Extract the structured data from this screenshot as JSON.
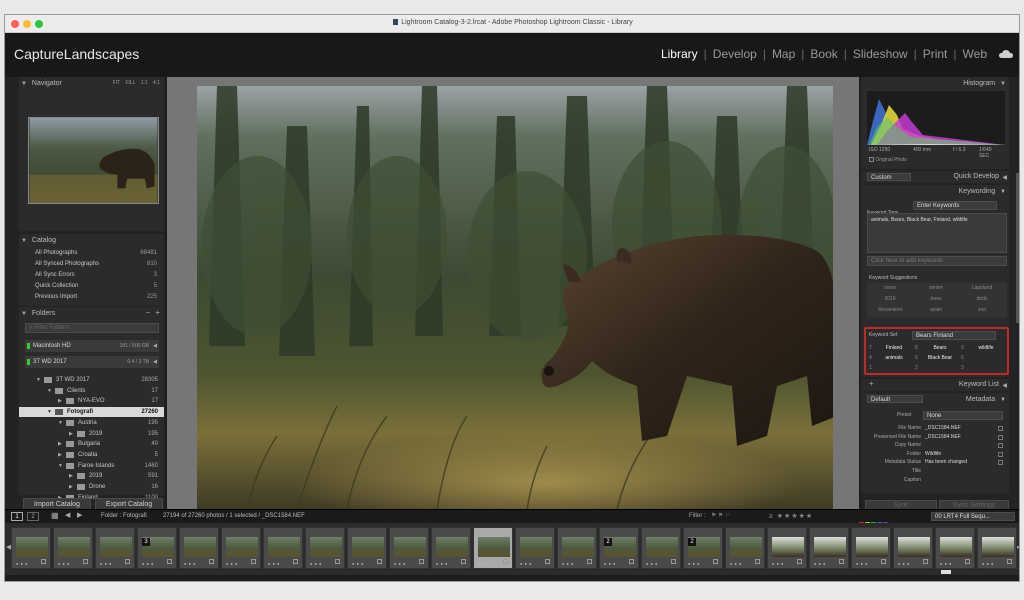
{
  "window": {
    "title": "Lightroom Catalog-3-2.lrcat - Adobe Photoshop Lightroom Classic - Library",
    "traffic_lights": [
      "#fd5f57",
      "#febc2e",
      "#28c840"
    ]
  },
  "identity": {
    "plate": "CaptureLandscapes",
    "modules": [
      {
        "label": "Library",
        "active": true
      },
      {
        "label": "Develop",
        "active": false
      },
      {
        "label": "Map",
        "active": false
      },
      {
        "label": "Book",
        "active": false
      },
      {
        "label": "Slideshow",
        "active": false
      },
      {
        "label": "Print",
        "active": false
      },
      {
        "label": "Web",
        "active": false
      }
    ],
    "cloud_icon": "cloud-icon"
  },
  "navigator": {
    "title": "Navigator",
    "zoom_options": [
      "FIT",
      "FILL",
      "1:1",
      "4:1"
    ]
  },
  "catalog": {
    "title": "Catalog",
    "items": [
      {
        "label": "All Photographs",
        "count": "68481"
      },
      {
        "label": "All Synced Photographs",
        "count": "810"
      },
      {
        "label": "All Sync Errors",
        "count": "3"
      },
      {
        "label": "Quick Collection",
        "count": "5"
      },
      {
        "label": "Previous Import",
        "count": "225"
      }
    ]
  },
  "folders": {
    "title": "Folders",
    "filter_placeholder": "Filter Folders",
    "volumes": [
      {
        "label": "Macintosh HD",
        "size": "181 / 500 GB"
      },
      {
        "label": "3T WD 2017",
        "size": "0.4 / 3 TB"
      }
    ],
    "tree": [
      {
        "label": "3T WD 2017",
        "count": "28305",
        "depth": 1,
        "open": true
      },
      {
        "label": "Clients",
        "count": "17",
        "depth": 2,
        "open": true
      },
      {
        "label": "NYA-EVO",
        "count": "17",
        "depth": 3,
        "open": false
      },
      {
        "label": "Fotografi",
        "count": "27260",
        "depth": 2,
        "open": true,
        "selected": true
      },
      {
        "label": "Austria",
        "count": "195",
        "depth": 3,
        "open": true
      },
      {
        "label": "2019",
        "count": "195",
        "depth": 4,
        "open": false
      },
      {
        "label": "Bulgaria",
        "count": "40",
        "depth": 3,
        "open": false
      },
      {
        "label": "Croatia",
        "count": "5",
        "depth": 3,
        "open": false
      },
      {
        "label": "Faroe Islands",
        "count": "1460",
        "depth": 3,
        "open": true
      },
      {
        "label": "2019",
        "count": "591",
        "depth": 4,
        "open": false
      },
      {
        "label": "Drone",
        "count": "16",
        "depth": 4,
        "open": false
      },
      {
        "label": "Finland",
        "count": "1100",
        "depth": 3,
        "open": false
      }
    ],
    "import_button": "Import Catalog",
    "export_button": "Export Catalog"
  },
  "histogram": {
    "title": "Histogram",
    "iso": "ISO 1250",
    "focal": "400 mm",
    "aperture": "f / 6.3",
    "shutter": "1/640 SEC",
    "original_photo": "Original Photo"
  },
  "quick_develop": {
    "title": "Quick Develop",
    "preset": "Custom"
  },
  "keywording": {
    "title": "Keywording",
    "tags_label": "Keyword Tags",
    "tags_dropdown": "Enter Keywords",
    "keywords_text": "animals, Bears, Black Bear, Finland, wildlife",
    "add_placeholder": "Click here to add keywords",
    "suggestions_label": "Keyword Suggestions",
    "suggestions": [
      "snow",
      "winter",
      "Lappland",
      "2019",
      "trees",
      "birds",
      "Rovaniemi",
      "spain",
      "zoo"
    ],
    "set_label": "Keyword Set",
    "set_value": "Bears Finland",
    "set_keywords": [
      {
        "key": "7",
        "label": "Finland"
      },
      {
        "key": "8",
        "label": "Bears"
      },
      {
        "key": "9",
        "label": "wildlife"
      },
      {
        "key": "4",
        "label": "animals"
      },
      {
        "key": "5",
        "label": "Black Bear"
      },
      {
        "key": "6",
        "label": ""
      },
      {
        "key": "1",
        "label": ""
      },
      {
        "key": "2",
        "label": ""
      },
      {
        "key": "3",
        "label": ""
      }
    ],
    "highlight_color": "#c0282a"
  },
  "keyword_list": {
    "title": "Keyword List"
  },
  "metadata": {
    "title": "Metadata",
    "view": "Default",
    "preset_label": "Preset",
    "preset_value": "None",
    "fields": [
      {
        "label": "File Name",
        "value": "_DSC1584.NEF"
      },
      {
        "label": "Preserved File Name",
        "value": "_DSC1584.NEF"
      },
      {
        "label": "Copy Name",
        "value": ""
      },
      {
        "label": "Folder",
        "value": "Wildlife"
      },
      {
        "label": "Metadata Status",
        "value": "Has been changed"
      },
      {
        "label": "Title",
        "value": ""
      },
      {
        "label": "Caption",
        "value": ""
      }
    ]
  },
  "sync": {
    "sync_button": "Sync",
    "sync_settings_button": "Sync Settings"
  },
  "filmstrip": {
    "page1": "1",
    "page2": "2",
    "source": "Folder : Fotografi",
    "status": "27194 of 27260 photos / 1 selected / _DSC1584.NEF",
    "filter_label": "Filter :",
    "filter_preset": "00 LRT4 Full Sequ...",
    "stack_counts": {
      "3": "3",
      "14": "2",
      "16": "2"
    }
  }
}
